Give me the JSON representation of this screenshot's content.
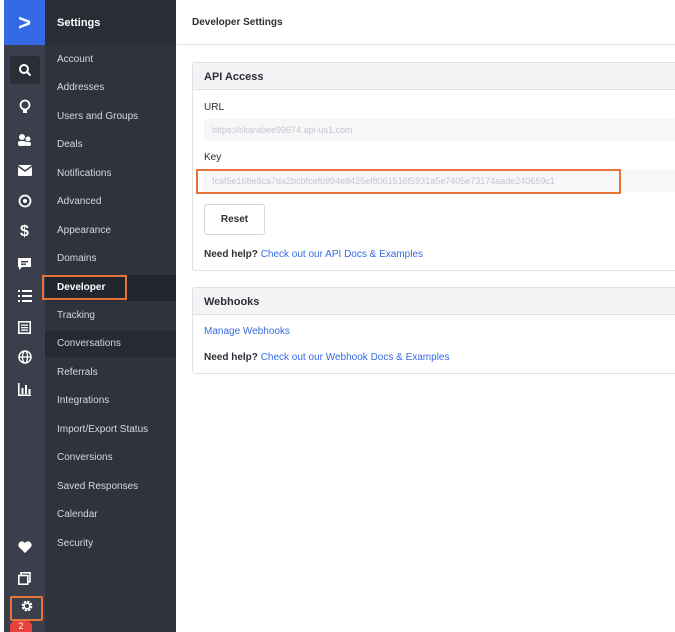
{
  "page": {
    "header_title": "Developer Settings"
  },
  "rail": {
    "logo_glyph": ">",
    "badge": "2",
    "icons": [
      "search-icon",
      "lightbulb-icon",
      "contacts-icon",
      "envelope-icon",
      "target-icon",
      "dollar-icon",
      "chat-icon",
      "list-icon",
      "document-icon",
      "globe-icon",
      "bar-chart-icon",
      "heart-icon",
      "copy-icon",
      "gear-icon"
    ]
  },
  "menu": {
    "title": "Settings",
    "items": [
      "Account",
      "Addresses",
      "Users and Groups",
      "Deals",
      "Notifications",
      "Advanced",
      "Appearance",
      "Domains",
      "Developer",
      "Tracking",
      "Conversations",
      "Referrals",
      "Integrations",
      "Import/Export Status",
      "Conversions",
      "Saved Responses",
      "Calendar",
      "Security"
    ],
    "active": "Developer"
  },
  "api_access": {
    "title": "API Access",
    "url_label": "URL",
    "url_value": "https://skarabee99674.api-us1.com",
    "key_label": "Key",
    "key_value": "fcaf5e168e8ca7da2bcbfcefb994e8425ef8061516f5931a5e7405e73174aade240659c1",
    "reset_label": "Reset",
    "help_prefix": "Need help?",
    "help_link": "Check out our API Docs & Examples"
  },
  "webhooks": {
    "title": "Webhooks",
    "manage_link": "Manage Webhooks",
    "help_prefix": "Need help?",
    "help_link": "Check out our Webhook Docs & Examples"
  },
  "colors": {
    "accent": "#356ae6",
    "highlight": "#e8733a",
    "rail_bg": "#3a3f4b",
    "menu_bg": "#2f333d"
  }
}
